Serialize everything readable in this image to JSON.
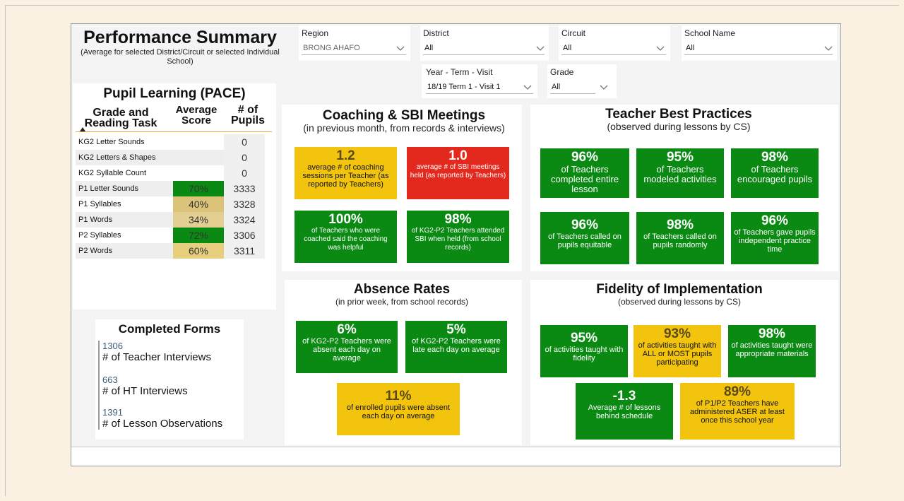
{
  "header": {
    "title": "Performance Summary",
    "subtitle": "(Average for selected District/Circuit or selected Individual School)"
  },
  "filters": {
    "region": {
      "label": "Region",
      "value": "BRONG AHAFO"
    },
    "district": {
      "label": "District",
      "value": "All"
    },
    "circuit": {
      "label": "Circuit",
      "value": "All"
    },
    "school": {
      "label": "School Name",
      "value": "All"
    },
    "year_term": {
      "label": "Year - Term - Visit",
      "value": "18/19 Term 1 - Visit 1"
    },
    "grade": {
      "label": "Grade",
      "value": "All"
    }
  },
  "pace": {
    "title": "Pupil Learning (PACE)",
    "col_task": "Grade and Reading Task",
    "col_score": "Average Score",
    "col_pupils": "# of Pupils",
    "rows": [
      {
        "task": "KG2 Letter Sounds",
        "score": "",
        "pupils": "0",
        "color": "#ffffff"
      },
      {
        "task": "KG2 Letters & Shapes",
        "score": "",
        "pupils": "0",
        "color": "#ffffff"
      },
      {
        "task": "KG2 Syllable Count",
        "score": "",
        "pupils": "0",
        "color": "#ffffff"
      },
      {
        "task": "P1 Letter Sounds",
        "score": "70%",
        "pupils": "3333",
        "color": "#0a8a12"
      },
      {
        "task": "P1 Syllables",
        "score": "40%",
        "pupils": "3328",
        "color": "#dcc37a"
      },
      {
        "task": "P1 Words",
        "score": "34%",
        "pupils": "3324",
        "color": "#e3cf91"
      },
      {
        "task": "P2 Syllables",
        "score": "72%",
        "pupils": "3306",
        "color": "#0a8a12"
      },
      {
        "task": "P2 Words",
        "score": "60%",
        "pupils": "3311",
        "color": "#e8cf7e"
      }
    ]
  },
  "forms": {
    "title": "Completed Forms",
    "items": [
      {
        "num": "1306",
        "label": "# of Teacher Interviews"
      },
      {
        "num": "663",
        "label": "# of HT Interviews"
      },
      {
        "num": "1391",
        "label": "# of Lesson Observations"
      }
    ]
  },
  "coaching": {
    "title": "Coaching & SBI Meetings",
    "subtitle": "(in previous month, from records & interviews)",
    "cards": [
      {
        "value": "1.2",
        "desc": "average # of coaching sessions per Teacher (as reported by Teachers)",
        "tone": "yellow"
      },
      {
        "value": "1.0",
        "desc": "average # of SBI meetings held (as reported by Teachers)",
        "tone": "red"
      },
      {
        "value": "100%",
        "desc": "of Teachers who were coached said the coaching was helpful",
        "tone": "green"
      },
      {
        "value": "98%",
        "desc": "of KG2-P2 Teachers attended SBI when held (from school records)",
        "tone": "green"
      }
    ]
  },
  "best_practices": {
    "title": "Teacher Best Practices",
    "subtitle": "(observed during lessons by CS)",
    "cards": [
      {
        "value": "96%",
        "desc": "of Teachers completed entire lesson",
        "tone": "green"
      },
      {
        "value": "95%",
        "desc": "of Teachers modeled activities",
        "tone": "green"
      },
      {
        "value": "98%",
        "desc": "of Teachers encouraged pupils",
        "tone": "green"
      },
      {
        "value": "96%",
        "desc": "of Teachers called on pupils equitable",
        "tone": "green"
      },
      {
        "value": "98%",
        "desc": "of Teachers called on pupils randomly",
        "tone": "green"
      },
      {
        "value": "96%",
        "desc": "of Teachers gave pupils independent practice time",
        "tone": "green"
      }
    ]
  },
  "absence": {
    "title": "Absence Rates",
    "subtitle": "(in prior week, from school records)",
    "cards": [
      {
        "value": "6%",
        "desc": "of KG2-P2 Teachers were absent each day on average",
        "tone": "green"
      },
      {
        "value": "5%",
        "desc": "of KG2-P2 Teachers were late each day on average",
        "tone": "green"
      },
      {
        "value": "11%",
        "desc": "of enrolled pupils were absent each day on average",
        "tone": "yellow"
      }
    ]
  },
  "fidelity": {
    "title": "Fidelity of Implementation",
    "subtitle": "(observed during lessons by CS)",
    "cards": [
      {
        "value": "95%",
        "desc": "of activities taught with fidelity",
        "tone": "green"
      },
      {
        "value": "93%",
        "desc": "of activities taught with ALL or MOST pupils participating",
        "tone": "yellow"
      },
      {
        "value": "98%",
        "desc": "of activities taught were appropriate materials",
        "tone": "green"
      },
      {
        "value": "-1.3",
        "desc": "Average # of lessons behind schedule",
        "tone": "green"
      },
      {
        "value": "89%",
        "desc": "of P1/P2 Teachers have administered ASER at least once this school year",
        "tone": "yellow"
      }
    ]
  }
}
